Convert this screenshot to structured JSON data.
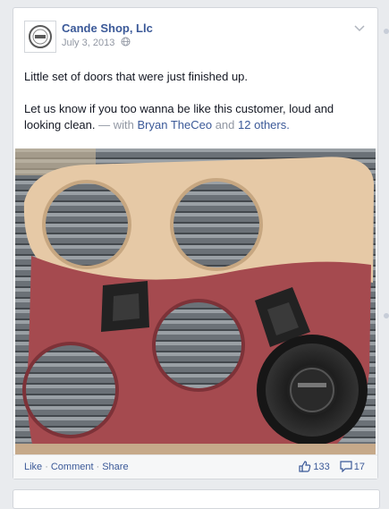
{
  "post": {
    "page_name": "Cande Shop, Llc",
    "date": "July 3, 2013",
    "text_line1": "Little set of doors that were just finished up.",
    "text_line2": "Let us know if you too wanna be like this customer, loud and looking clean.",
    "with_prefix": "— with",
    "tagged_person": "Bryan TheCeo",
    "and_word": "and",
    "tagged_others": "12 others.",
    "icons": {
      "avatar": "shop-logo",
      "privacy": "globe-icon",
      "menu": "chevron-down-icon"
    }
  },
  "footer": {
    "like_label": "Like",
    "comment_label": "Comment",
    "share_label": "Share",
    "separator": "·",
    "likes_count": "133",
    "comments_count": "17",
    "icons": {
      "likes": "thumbs-up-icon",
      "comments": "comment-icon"
    }
  },
  "colors": {
    "link": "#3b5998",
    "meta": "#9197a3",
    "text": "#141823",
    "background": "#e9ebee"
  }
}
